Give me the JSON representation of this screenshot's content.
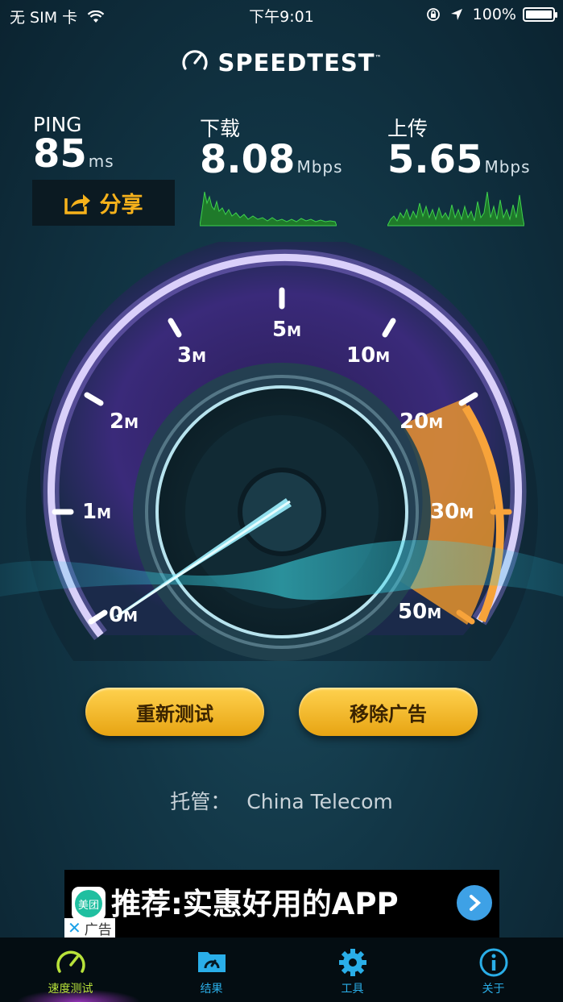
{
  "status_bar": {
    "carrier": "无 SIM 卡",
    "time": "下午9:01",
    "battery": "100%",
    "icons": [
      "wifi-icon",
      "rotation-lock-icon",
      "location-arrow-icon",
      "battery-icon"
    ]
  },
  "header": {
    "logo_text": "SPEEDTEST",
    "logo_mark": "™"
  },
  "stats": {
    "ping": {
      "label": "PING",
      "value": "85",
      "unit": "ms"
    },
    "download": {
      "label": "下载",
      "value": "8.08",
      "unit": "Mbps"
    },
    "upload": {
      "label": "上传",
      "value": "5.65",
      "unit": "Mbps"
    },
    "share_label": "分享"
  },
  "gauge": {
    "ticks": [
      {
        "num": "0",
        "unit": "M"
      },
      {
        "num": "1",
        "unit": "M"
      },
      {
        "num": "2",
        "unit": "M"
      },
      {
        "num": "3",
        "unit": "M"
      },
      {
        "num": "5",
        "unit": "M"
      },
      {
        "num": "10",
        "unit": "M"
      },
      {
        "num": "20",
        "unit": "M"
      },
      {
        "num": "30",
        "unit": "M"
      },
      {
        "num": "50",
        "unit": "M"
      }
    ],
    "accent_color": "#f39a2a",
    "ring_color": "#7d5fd6"
  },
  "buttons": {
    "retest": "重新测试",
    "remove_ads": "移除广告"
  },
  "host": {
    "label": "托管：",
    "name": "China Telecom"
  },
  "ad": {
    "text": "推荐:实惠好用的APP",
    "logo_text": "美团",
    "tag": "广告",
    "close": "✕"
  },
  "tabbar": [
    {
      "label": "速度测试",
      "icon": "speedometer-icon",
      "active": true
    },
    {
      "label": "结果",
      "icon": "results-folder-icon",
      "active": false
    },
    {
      "label": "工具",
      "icon": "gear-icon",
      "active": false
    },
    {
      "label": "关于",
      "icon": "info-icon",
      "active": false
    }
  ]
}
